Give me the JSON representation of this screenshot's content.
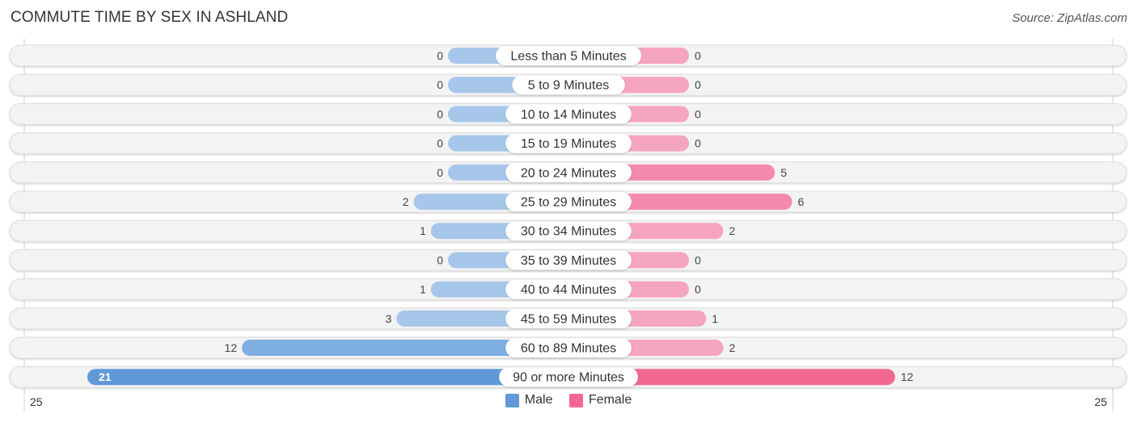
{
  "title": "COMMUTE TIME BY SEX IN ASHLAND",
  "source": "Source: ZipAtlas.com",
  "colors": {
    "male_light": "#a7c7ea",
    "male_dark": "#6199d8",
    "female_light": "#f6a5be",
    "female_dark": "#f06892",
    "row_bg": "#f3f3f3",
    "row_border": "#dcdcdc"
  },
  "legend": [
    {
      "label": "Male",
      "color": "#6199d8"
    },
    {
      "label": "Female",
      "color": "#f06892"
    }
  ],
  "axis": {
    "left_label": "25",
    "right_label": "25"
  },
  "chart_data": {
    "type": "bar",
    "orientation": "horizontal-diverging",
    "title": "COMMUTE TIME BY SEX IN ASHLAND",
    "categories": [
      "Less than 5 Minutes",
      "5 to 9 Minutes",
      "10 to 14 Minutes",
      "15 to 19 Minutes",
      "20 to 24 Minutes",
      "25 to 29 Minutes",
      "30 to 34 Minutes",
      "35 to 39 Minutes",
      "40 to 44 Minutes",
      "45 to 59 Minutes",
      "60 to 89 Minutes",
      "90 or more Minutes"
    ],
    "series": [
      {
        "name": "Male",
        "values": [
          0,
          0,
          0,
          0,
          0,
          2,
          1,
          0,
          1,
          3,
          12,
          21
        ]
      },
      {
        "name": "Female",
        "values": [
          0,
          0,
          0,
          0,
          5,
          6,
          2,
          0,
          0,
          1,
          2,
          12
        ]
      }
    ],
    "xlim": [
      25,
      25
    ],
    "xlabel": "",
    "ylabel": "",
    "legend_position": "bottom-center",
    "grid": false
  }
}
